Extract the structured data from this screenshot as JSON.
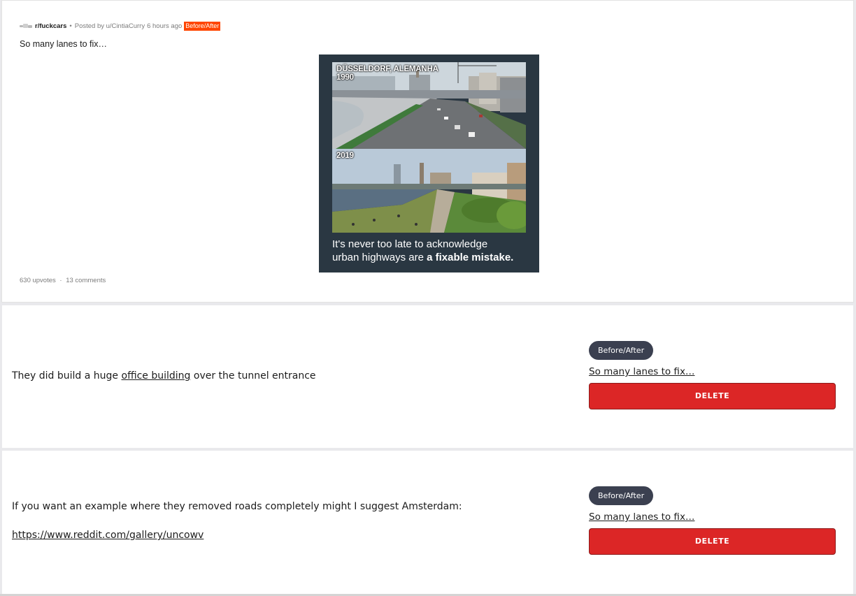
{
  "post": {
    "subreddit": "r/fuckcars",
    "separator": "•",
    "posted_by": "Posted by u/CintiaCurry",
    "time_ago": "6 hours ago",
    "flair": "Before/After",
    "title": "So many lanes to fix…",
    "image": {
      "top_label_line1": "DÜSSELDORF, ALEMANHA",
      "top_label_line2": "1990",
      "bottom_label": "2019",
      "caption_line1": "It's never too late to acknowledge",
      "caption_line2_plain": "urban highways are ",
      "caption_line2_bold": "a fixable mistake."
    },
    "upvotes": "630 upvotes",
    "stats_separator": "·",
    "comments": "13 comments"
  },
  "comments": [
    {
      "text_before": "They did build a huge ",
      "link_text": "office building",
      "text_after": " over the tunnel entrance",
      "flair": "Before/After",
      "post_link": "So many lanes to fix…",
      "delete_label": "DELETE"
    },
    {
      "text": "If you want an example where they removed roads completely might I suggest Amsterdam:",
      "link_text": "https://www.reddit.com/gallery/uncowv",
      "flair": "Before/After",
      "post_link": "So many lanes to fix…",
      "delete_label": "DELETE"
    }
  ],
  "colors": {
    "flair_orange": "#ff4500",
    "delete_red": "#dc2626",
    "pill_dark": "#3b4050",
    "image_bg": "#2a3742"
  }
}
